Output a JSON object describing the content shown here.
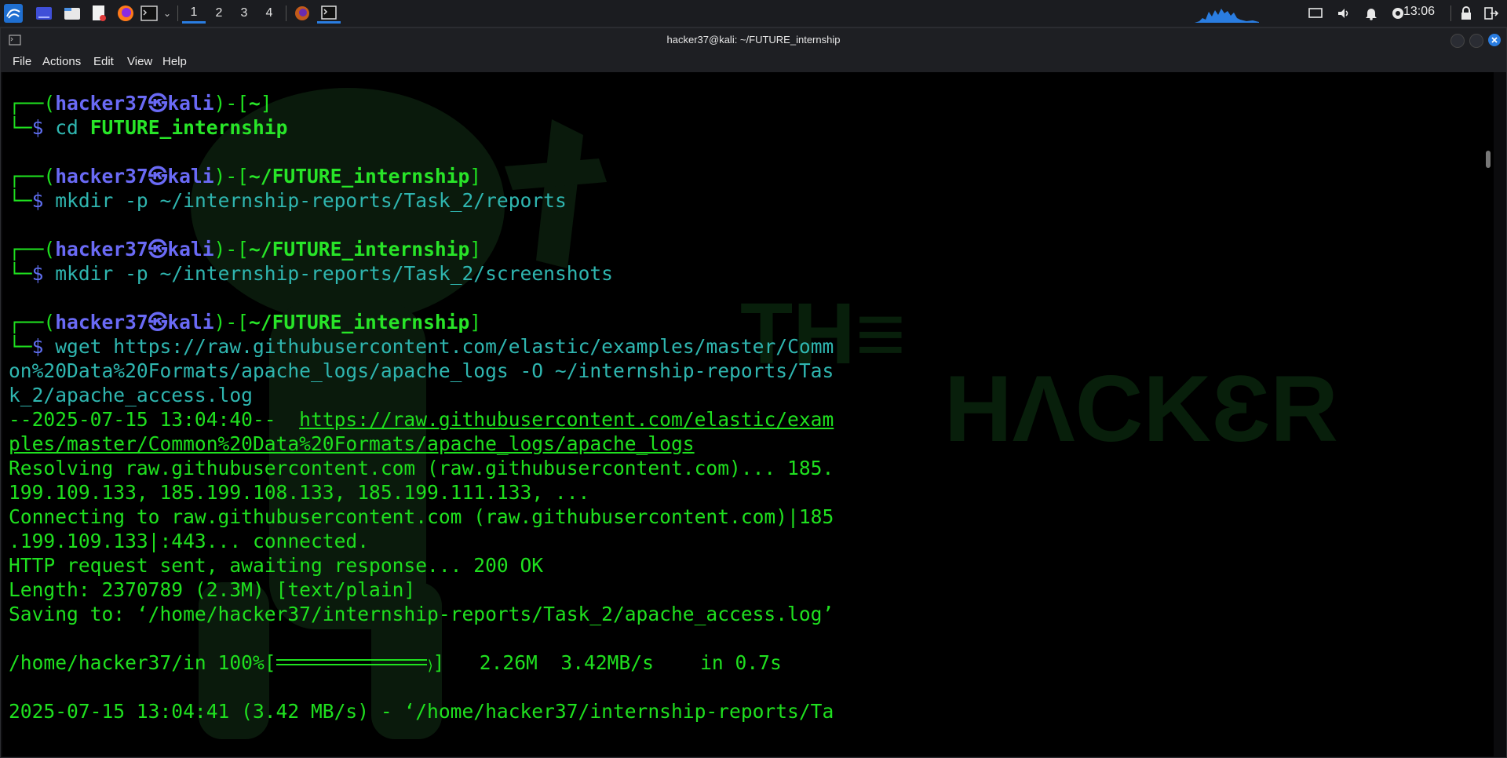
{
  "panel": {
    "workspaces": [
      "1",
      "2",
      "3",
      "4"
    ],
    "active_workspace": "1",
    "clock": "13:06",
    "icons": [
      "kali-menu-icon",
      "desktop-icon",
      "file-manager-icon",
      "text-editor-icon",
      "firefox-icon",
      "terminal-icon",
      "chevron-down-icon",
      "firefox-task-icon",
      "terminal-task-icon",
      "cpu-graph-icon",
      "display-icon",
      "volume-icon",
      "bell-icon",
      "power-icon",
      "lock-icon",
      "logout-icon"
    ]
  },
  "window": {
    "title": "hacker37@kali: ~/FUTURE_internship",
    "menu": [
      "File",
      "Actions",
      "Edit",
      "View",
      "Help"
    ]
  },
  "terminal": {
    "user": "hacker37",
    "host": "kali",
    "prompts": [
      {
        "cwd": "~",
        "command": "cd",
        "args": "FUTURE_internship"
      },
      {
        "cwd": "~/FUTURE_internship",
        "command": "mkdir",
        "args": "-p ~/internship-reports/Task_2/reports"
      },
      {
        "cwd": "~/FUTURE_internship",
        "command": "mkdir",
        "args": "-p ~/internship-reports/Task_2/screenshots"
      },
      {
        "cwd": "~/FUTURE_internship",
        "command": "wget",
        "args": "https://raw.githubusercontent.com/elastic/examples/master/Comm"
      }
    ],
    "wget_args_cont": [
      "on%20Data%20Formats/apache_logs/apache_logs -O ~/internship-reports/Tas",
      "k_2/apache_access.log"
    ],
    "output": {
      "start_time": "--2025-07-15 13:04:40--  ",
      "url_1": "https://raw.githubusercontent.com/elastic/exam",
      "url_2": "ples/master/Common%20Data%20Formats/apache_logs/apache_logs",
      "resolving_1": "Resolving raw.githubusercontent.com (raw.githubusercontent.com)... 185.",
      "resolving_2": "199.109.133, 185.199.108.133, 185.199.111.133, ...",
      "connecting_1": "Connecting to raw.githubusercontent.com (raw.githubusercontent.com)|185",
      "connecting_2": ".199.109.133|:443... connected.",
      "http": "HTTP request sent, awaiting response... 200 OK",
      "length": "Length: 2370789 (2.3M) [text/plain]",
      "saving": "Saving to: ‘/home/hacker37/internship-reports/Task_2/apache_access.log’",
      "progress_prefix": "/home/hacker37/in 100%[",
      "progress_fraction": 1.0,
      "progress_suffix": "]   2.26M  3.42MB/s    in 0.7s",
      "done": "2025-07-15 13:04:41 (3.42 MB/s) - ‘/home/hacker37/internship-reports/Ta"
    }
  }
}
